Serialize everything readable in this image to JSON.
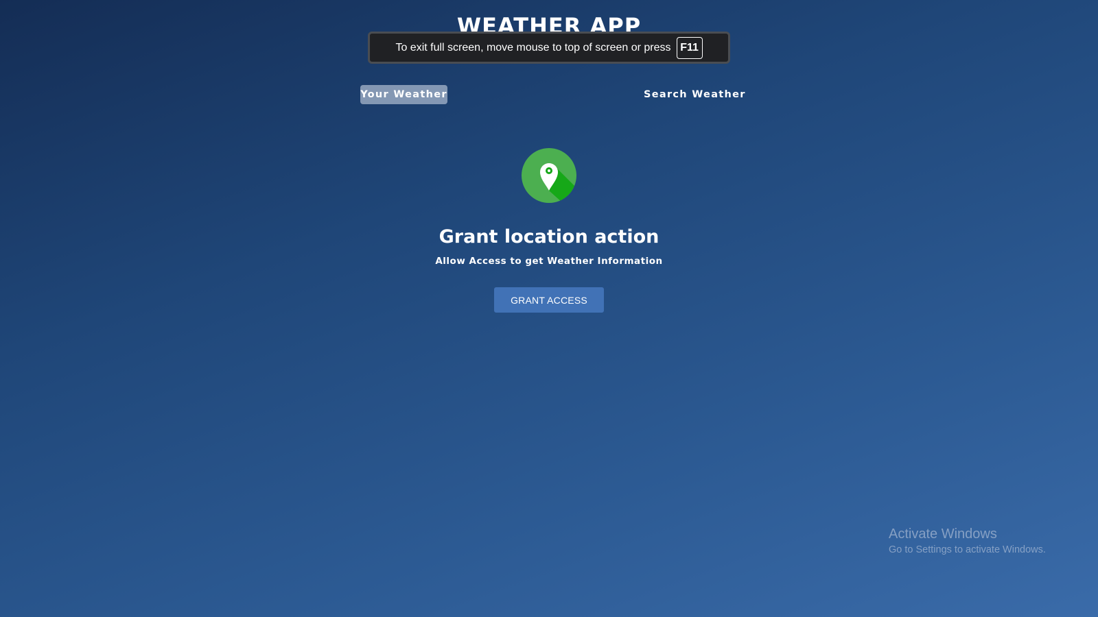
{
  "app": {
    "title": "WEATHER APP"
  },
  "fullscreen_notice": {
    "message": "To exit full screen, move mouse to top of screen or press",
    "key": "F11"
  },
  "tabs": [
    {
      "label": "Your Weather",
      "active": true
    },
    {
      "label": "Search Weather",
      "active": false
    }
  ],
  "grant": {
    "icon": "location-pin-icon",
    "icon_colors": {
      "circle": "#4caf50",
      "shadow": "#16a818",
      "pin": "#ffffff"
    },
    "title": "Grant location action",
    "subtitle": "Allow Access to get Weather Information",
    "button_label": "GRANT ACCESS",
    "button_color": "#4172b6"
  },
  "watermark": {
    "title": "Activate Windows",
    "subtitle": "Go to Settings to activate Windows."
  },
  "colors": {
    "background_start": "#142d55",
    "background_end": "#3a6ba9"
  }
}
